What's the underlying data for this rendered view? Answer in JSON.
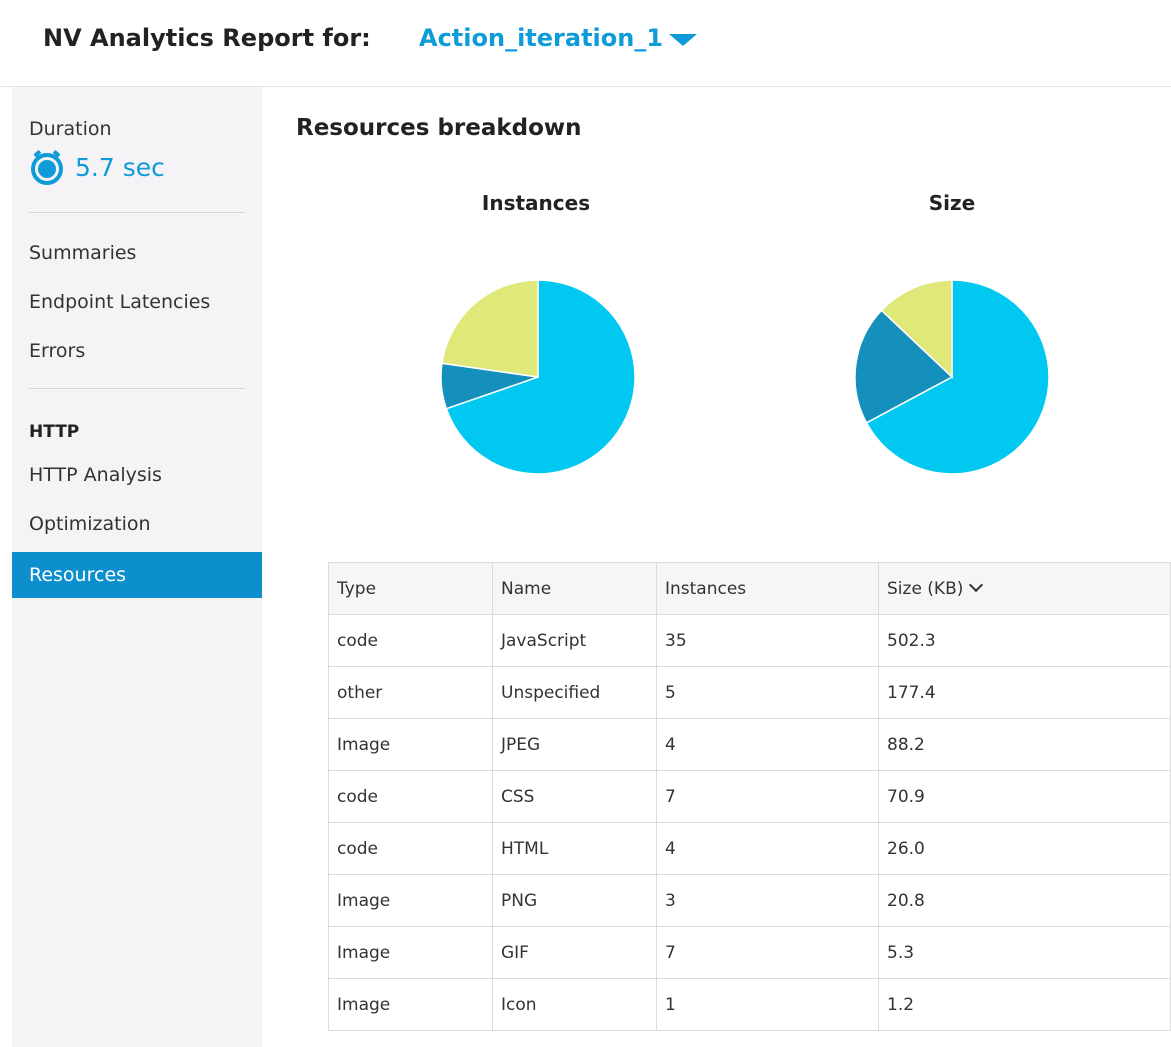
{
  "header": {
    "title": "NV Analytics Report for:",
    "action": "Action_iteration_1"
  },
  "sidebar": {
    "duration_label": "Duration",
    "duration_value": "5.7 sec",
    "items_top": [
      {
        "label": "Summaries"
      },
      {
        "label": "Endpoint Latencies"
      },
      {
        "label": "Errors"
      }
    ],
    "section_label": "HTTP",
    "items_http": [
      {
        "label": "HTTP Analysis"
      },
      {
        "label": "Optimization"
      },
      {
        "label": "Resources",
        "active": true
      }
    ]
  },
  "main": {
    "title": "Resources breakdown",
    "charts": [
      {
        "title": "Instances"
      },
      {
        "title": "Size"
      }
    ]
  },
  "colors": {
    "accent": "#0d9cd8",
    "active_nav": "#0d8fce",
    "pie_code": "#00c8f0",
    "pie_other": "#1590bd",
    "pie_image": "#e0e87a"
  },
  "chart_data": [
    {
      "type": "pie",
      "title": "Instances",
      "categories": [
        "code",
        "other",
        "Image"
      ],
      "values": [
        46,
        5,
        15
      ],
      "colors": [
        "#00c8f0",
        "#1590bd",
        "#e0e87a"
      ]
    },
    {
      "type": "pie",
      "title": "Size",
      "categories": [
        "code",
        "other",
        "Image"
      ],
      "values": [
        599.2,
        177.4,
        115.5
      ],
      "colors": [
        "#00c8f0",
        "#1590bd",
        "#e0e87a"
      ]
    }
  ],
  "table": {
    "columns": [
      "Type",
      "Name",
      "Instances",
      "Size (KB)"
    ],
    "rows": [
      [
        "code",
        "JavaScript",
        "35",
        "502.3"
      ],
      [
        "other",
        "Unspecified",
        "5",
        "177.4"
      ],
      [
        "Image",
        "JPEG",
        "4",
        "88.2"
      ],
      [
        "code",
        "CSS",
        "7",
        "70.9"
      ],
      [
        "code",
        "HTML",
        "4",
        "26.0"
      ],
      [
        "Image",
        "PNG",
        "3",
        "20.8"
      ],
      [
        "Image",
        "GIF",
        "7",
        "5.3"
      ],
      [
        "Image",
        "Icon",
        "1",
        "1.2"
      ]
    ]
  }
}
